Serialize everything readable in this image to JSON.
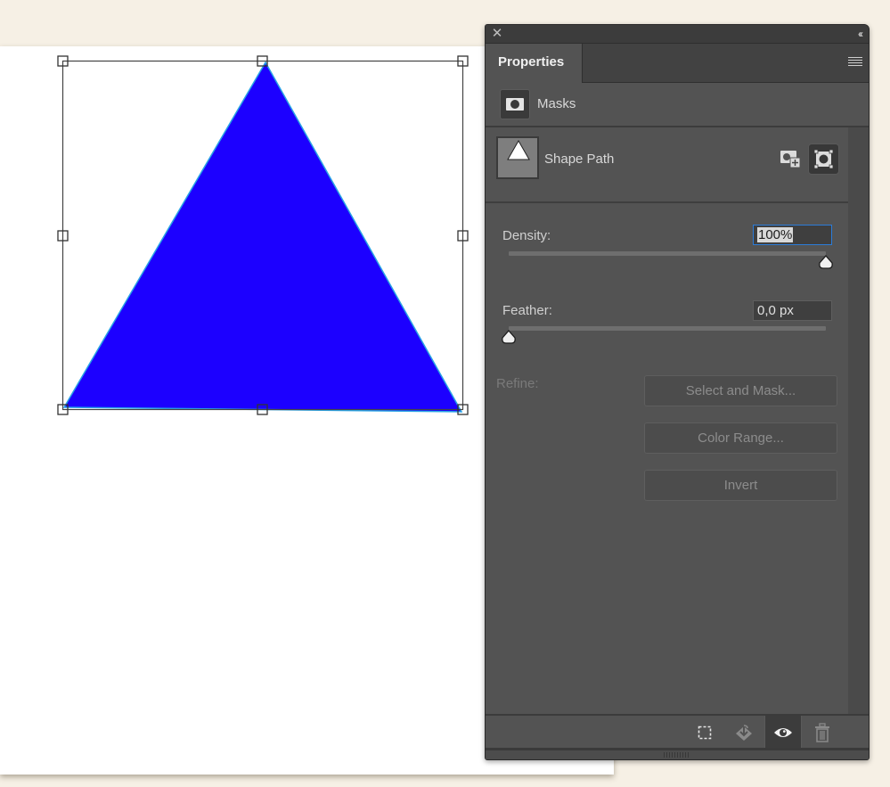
{
  "canvas": {
    "shape": "triangle",
    "fill_color": "#1c00ff",
    "edge_color": "#29a3e6",
    "selection_handles": 8
  },
  "panel": {
    "close_icon": "close-icon",
    "collapse_label": "‹‹",
    "tab_label": "Properties",
    "menu_icon": "hamburger-menu-icon"
  },
  "masks": {
    "label": "Masks",
    "icon": "pixel-mask-icon"
  },
  "shape_path": {
    "label": "Shape Path",
    "add_pixel_mask_icon": "add-pixel-mask-icon",
    "vector_mask_icon": "vector-mask-icon"
  },
  "density": {
    "label": "Density:",
    "value": "100%",
    "percent": 100
  },
  "feather": {
    "label": "Feather:",
    "value": "0,0 px",
    "percent": 0
  },
  "refine": {
    "label": "Refine:",
    "buttons": [
      "Select and Mask...",
      "Color Range...",
      "Invert"
    ]
  },
  "footer": {
    "icons": [
      "load-selection-icon",
      "apply-mask-icon",
      "visibility-eye-icon",
      "delete-trash-icon"
    ]
  },
  "colors": {
    "panel_bg": "#535353",
    "focus_border": "#2b7cd9",
    "page_bg": "#f6f0e5"
  }
}
